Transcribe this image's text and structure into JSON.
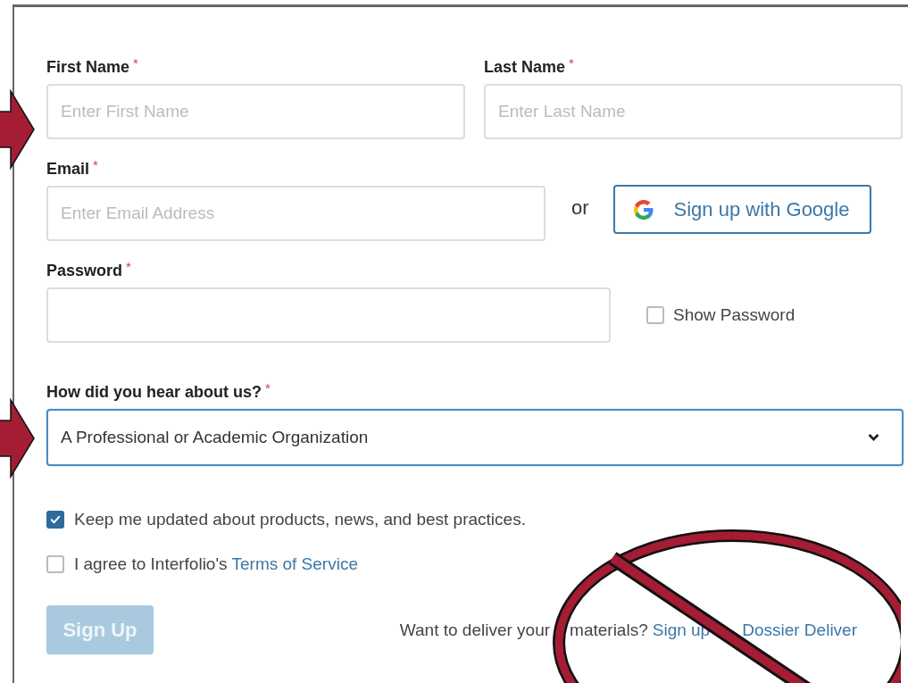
{
  "name_fields": [
    {
      "label": "First Name",
      "required_mark": "*",
      "placeholder": "Enter First Name"
    },
    {
      "label": "Last Name",
      "required_mark": "*",
      "placeholder": "Enter Last Name"
    }
  ],
  "email": {
    "label": "Email",
    "required_mark": "*",
    "placeholder": "Enter Email Address"
  },
  "or_text": "or",
  "google_button": {
    "label": "Sign up with Google"
  },
  "password": {
    "label": "Password",
    "required_mark": "*"
  },
  "show_password": {
    "label": "Show Password",
    "checked": false
  },
  "referral": {
    "label": "How did you hear about us?",
    "required_mark": "*",
    "value": "A Professional or Academic Organization"
  },
  "options": [
    {
      "text": "Keep me updated about products, news, and best practices.",
      "checked": true
    },
    {
      "text": "I agree to Interfolio's",
      "link": "Terms of Service",
      "checked": false
    }
  ],
  "sign_up_button": {
    "label": "Sign Up",
    "disabled": true
  },
  "footer": {
    "text_parts": [
      "Want to deliver your",
      "materials?"
    ],
    "link_parts": [
      "Sign up",
      "Dossier Deliver"
    ]
  },
  "annotations": [
    {
      "kind": "arrow"
    },
    {
      "kind": "arrow"
    },
    {
      "kind": "no-sign"
    }
  ]
}
